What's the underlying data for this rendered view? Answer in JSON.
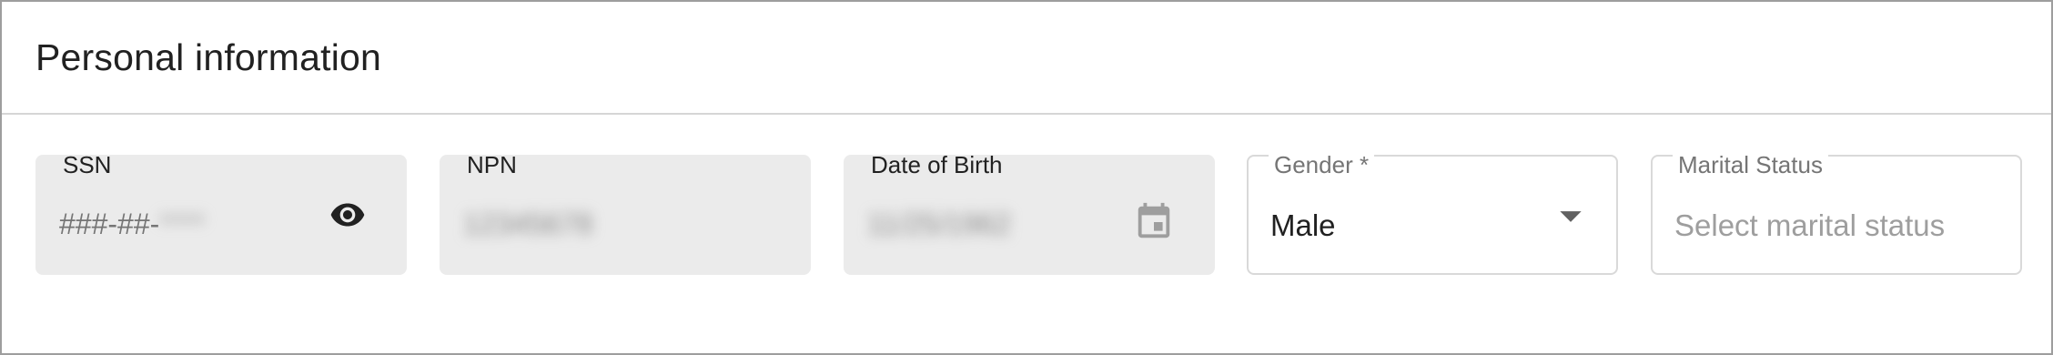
{
  "section": {
    "title": "Personal information"
  },
  "fields": {
    "ssn": {
      "label": "SSN",
      "prefix": "###-##-",
      "masked_value": "****"
    },
    "npn": {
      "label": "NPN",
      "value": "12345678"
    },
    "dob": {
      "label": "Date of Birth",
      "value": "11/25/1962"
    },
    "gender": {
      "label": "Gender *",
      "value": "Male"
    },
    "marital_status": {
      "label": "Marital Status",
      "placeholder": "Select marital status"
    }
  },
  "icons": {
    "ssn_toggle": "eye-icon",
    "dob_picker": "calendar-icon",
    "gender_dropdown": "triangle-down-icon"
  },
  "colors": {
    "filled_field_bg": "#ebebeb",
    "outline_border": "#d9d9d9",
    "icon_dark": "#212121",
    "icon_disabled": "#9e9e9e"
  }
}
